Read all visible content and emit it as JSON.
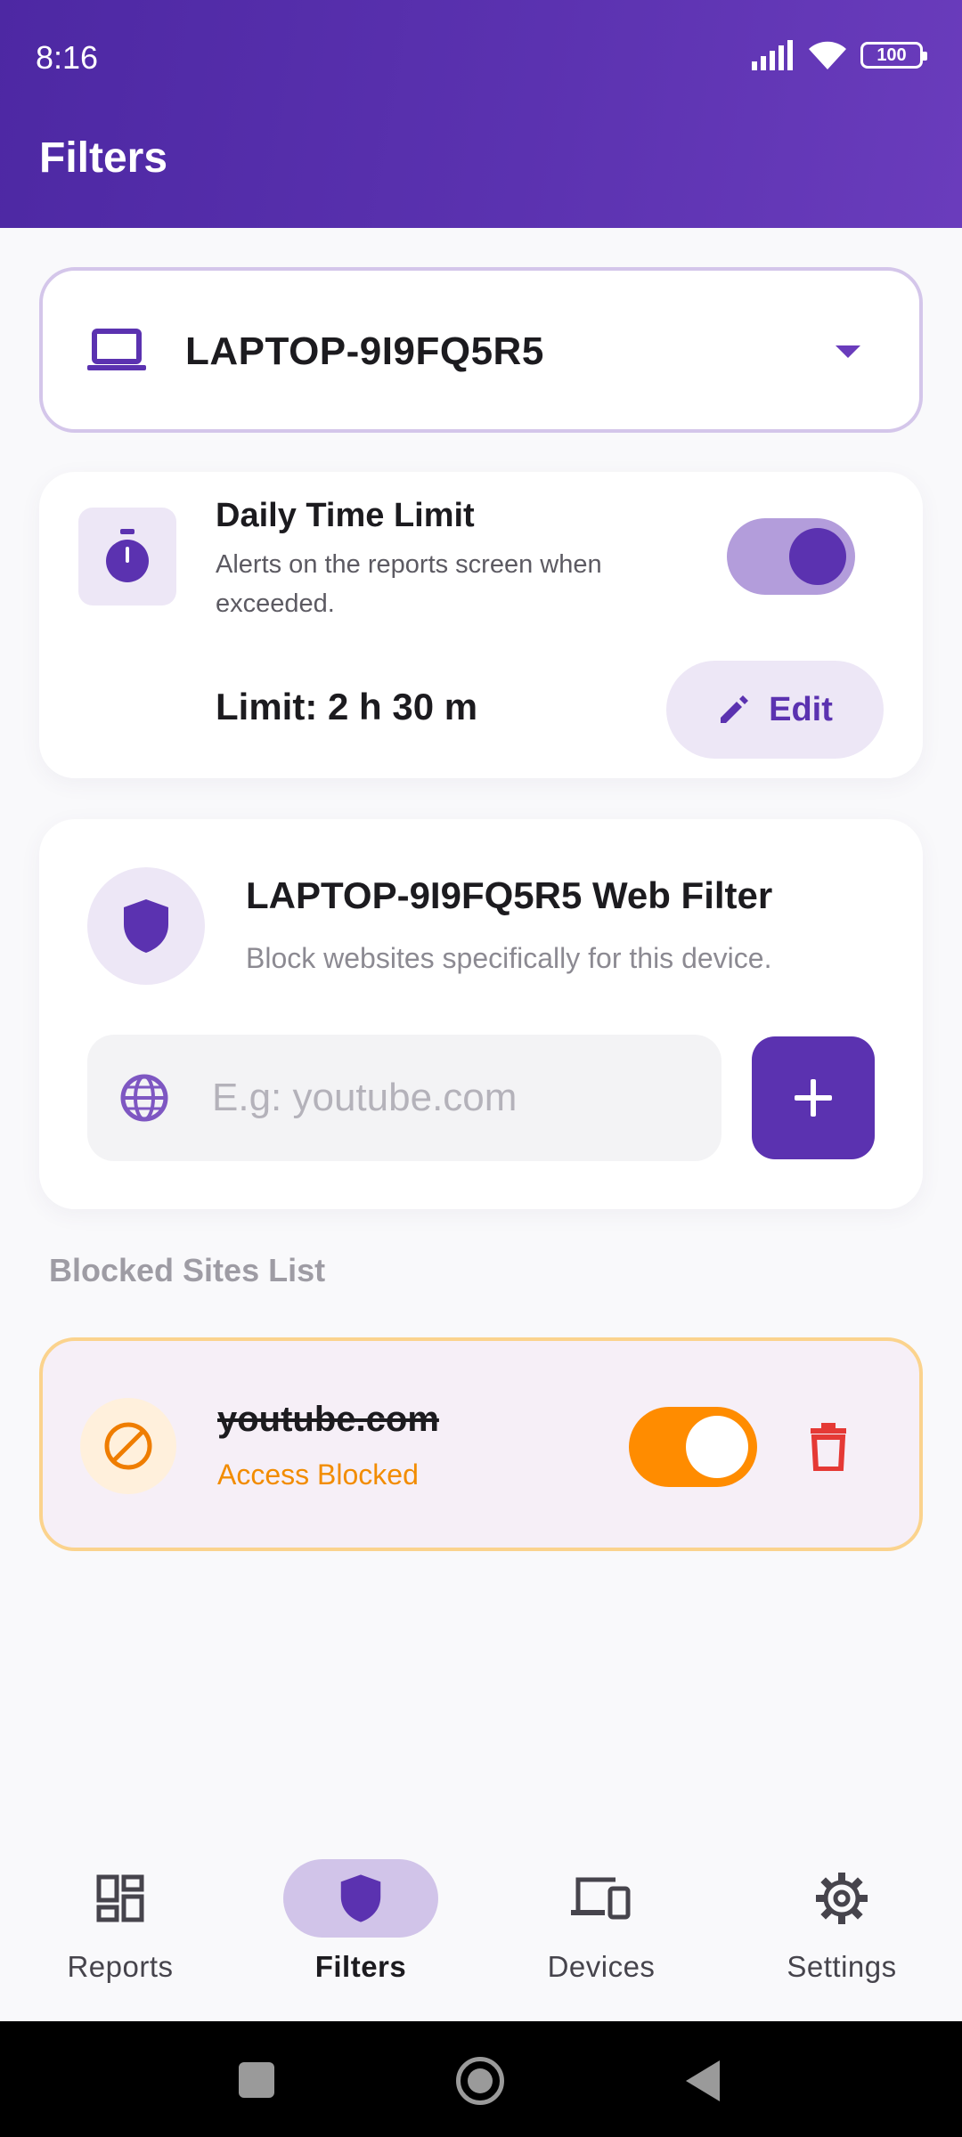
{
  "status_bar": {
    "time": "8:16",
    "battery": "100",
    "icons": [
      "signal-icon",
      "wifi-icon",
      "battery-icon"
    ]
  },
  "header": {
    "title": "Filters"
  },
  "device_selector": {
    "device_name": "LAPTOP-9I9FQ5R5",
    "icon": "laptop-icon"
  },
  "time_limit": {
    "title": "Daily Time Limit",
    "description": "Alerts on the reports screen when exceeded.",
    "enabled": true,
    "limit_text": "Limit: 2 h 30 m",
    "edit_label": "Edit"
  },
  "web_filter": {
    "title": "LAPTOP-9I9FQ5R5 Web Filter",
    "description": "Block websites specifically for this device.",
    "input_placeholder": "E.g: youtube.com",
    "input_value": ""
  },
  "blocked_list": {
    "section_label": "Blocked Sites List",
    "items": [
      {
        "site": "youtube.com",
        "status": "Access Blocked",
        "enabled": true
      }
    ]
  },
  "bottom_nav": {
    "items": [
      {
        "label": "Reports",
        "icon": "dashboard-icon",
        "active": false
      },
      {
        "label": "Filters",
        "icon": "shield-icon",
        "active": true
      },
      {
        "label": "Devices",
        "icon": "devices-icon",
        "active": false
      },
      {
        "label": "Settings",
        "icon": "gear-icon",
        "active": false
      }
    ]
  },
  "colors": {
    "primary": "#5b32b0",
    "primary_light": "#ede7f6",
    "accent_orange": "#ff8c00",
    "danger": "#e53935"
  }
}
